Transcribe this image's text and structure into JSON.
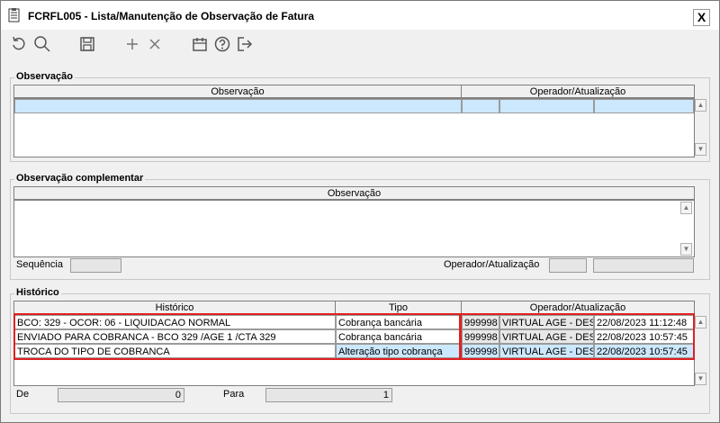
{
  "window": {
    "title": "FCRFL005 - Lista/Manutenção de Observação de Fatura",
    "close_label": "X"
  },
  "toolbar": {
    "icons": [
      "refresh-icon",
      "search-icon",
      "save-icon",
      "add-icon",
      "delete-icon",
      "calendar-icon",
      "help-icon",
      "exit-icon"
    ]
  },
  "observacao": {
    "title": "Observação",
    "columns": [
      "Observação",
      "Operador/Atualização"
    ]
  },
  "complementar": {
    "title": "Observação complementar",
    "column": "Observação",
    "sequencia_label": "Sequência",
    "operador_label": "Operador/Atualização"
  },
  "historico": {
    "title": "Histórico",
    "columns": [
      "Histórico",
      "Tipo",
      "Operador/Atualização"
    ],
    "rows": [
      {
        "historico": "BCO: 329 - OCOR: 06 - LIQUIDACAO NORMAL",
        "tipo": "Cobrança bancária",
        "codigo": "999998",
        "operador": "VIRTUAL AGE - DESE",
        "data": "22/08/2023 11:12:48"
      },
      {
        "historico": "ENVIADO PARA COBRANCA - BCO 329 /AGE 1 /CTA 329",
        "tipo": "Cobrança bancária",
        "codigo": "999998",
        "operador": "VIRTUAL AGE - DESE",
        "data": "22/08/2023 10:57:45"
      },
      {
        "historico": "TROCA DO TIPO DE COBRANCA",
        "tipo": "Alteração tipo cobrança",
        "codigo": "999998",
        "operador": "VIRTUAL AGE - DESE",
        "data": "22/08/2023 10:57:45"
      }
    ],
    "de_label": "De",
    "de_value": "0",
    "para_label": "Para",
    "para_value": "1"
  },
  "colors": {
    "highlight": "#e02020",
    "selection": "#cce8ff"
  }
}
